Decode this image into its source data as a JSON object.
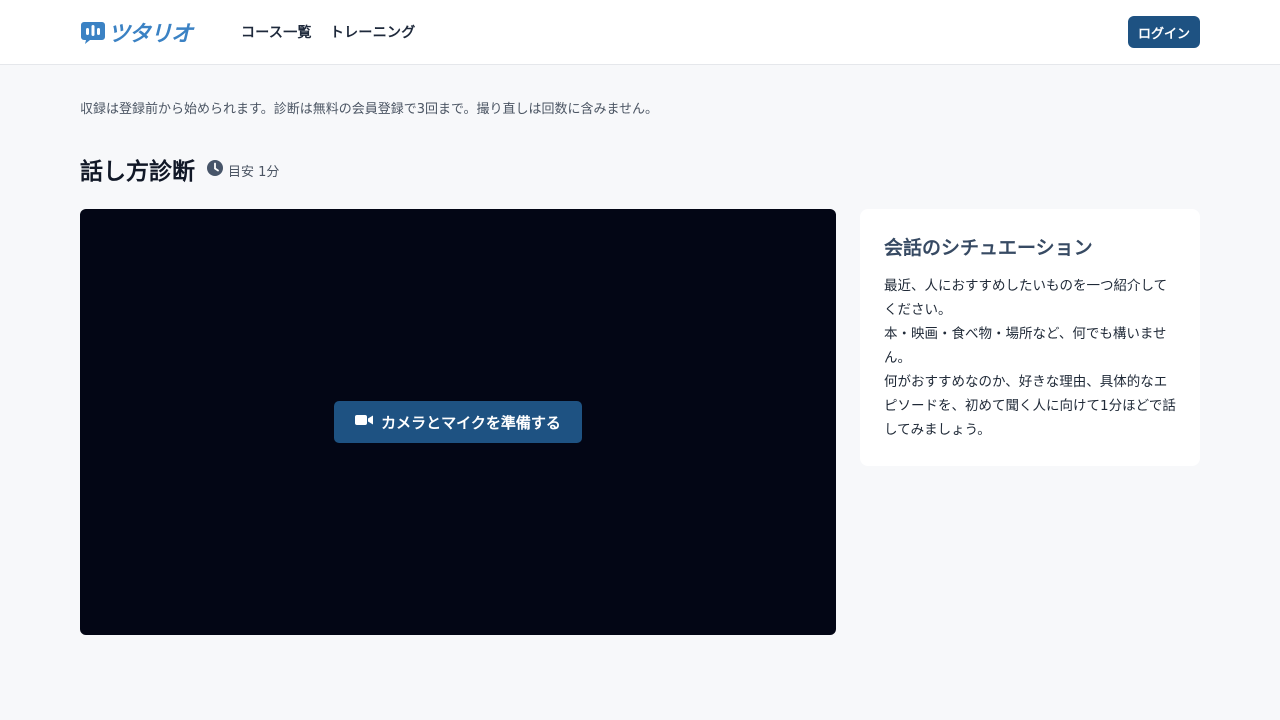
{
  "header": {
    "logo_text": "ツタリオ",
    "nav": [
      {
        "label": "コース一覧"
      },
      {
        "label": "トレーニング"
      }
    ],
    "login_label": "ログイン"
  },
  "notice": "収録は登録前から始められます。診断は無料の会員登録で3回まで。撮り直しは回数に含みません。",
  "page": {
    "title": "話し方診断",
    "duration": "目安 1分"
  },
  "video": {
    "prepare_label": "カメラとマイクを準備する"
  },
  "situation": {
    "title": "会話のシチュエーション",
    "paragraphs": [
      "最近、人におすすめしたいものを一つ紹介してください。",
      "本・映画・食べ物・場所など、何でも構いません。",
      "何がおすすめなのか、好きな理由、具体的なエピソードを、初めて聞く人に向けて1分ほどで話してみましょう。"
    ]
  },
  "colors": {
    "brand": "#3b82c4",
    "primary_button": "#1e5282",
    "video_bg": "#030615",
    "page_bg": "#f7f8fa"
  },
  "icons": {
    "logo": "speech-bubble-logo-icon",
    "duration": "clock-icon",
    "prepare": "video-camera-icon"
  }
}
